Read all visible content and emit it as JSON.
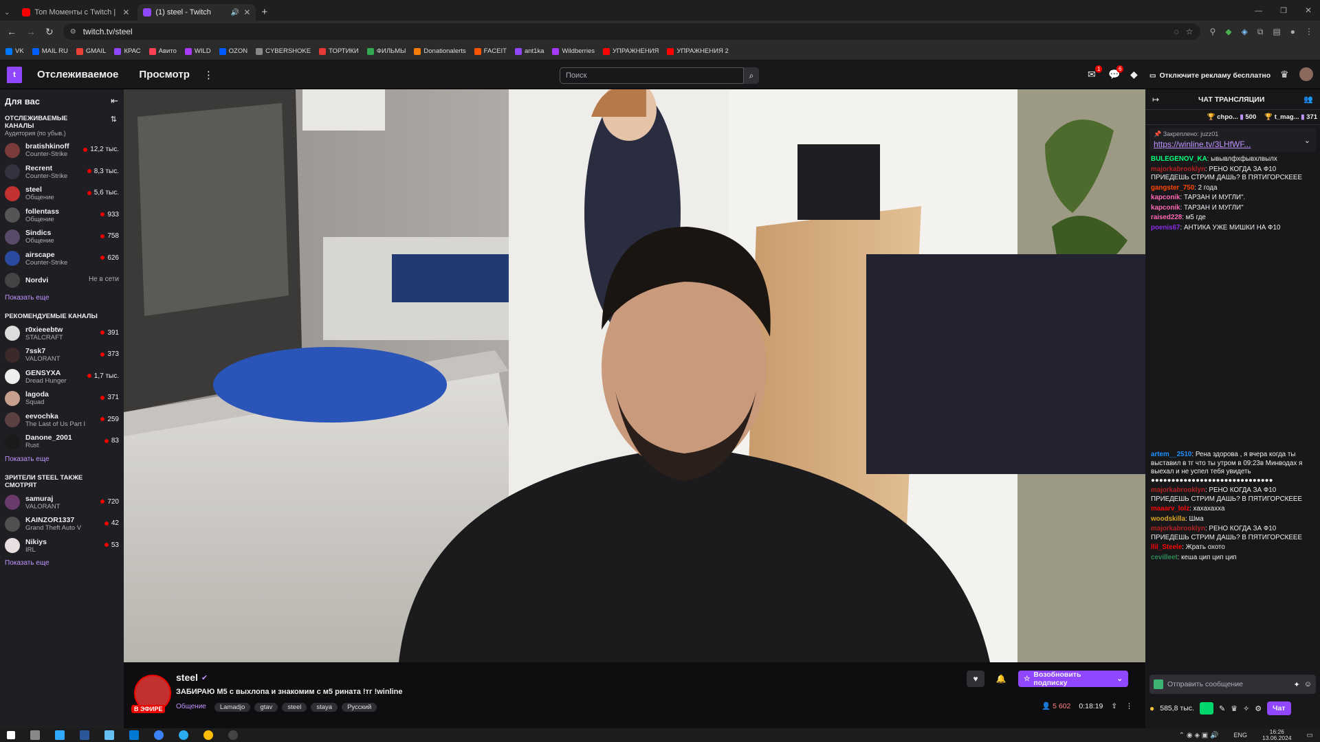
{
  "browser": {
    "tabs": [
      {
        "title": "Топ Моменты с Twitch | Попы…",
        "color": "#ff0000"
      },
      {
        "title": "(1) steel - Twitch",
        "color": "#9147ff"
      }
    ],
    "url": "twitch.tv/steel",
    "bookmarks": [
      {
        "label": "VK",
        "color": "#0077ff"
      },
      {
        "label": "MAIL RU",
        "color": "#005ff9"
      },
      {
        "label": "GMAIL",
        "color": "#ea4335"
      },
      {
        "label": "КРАС",
        "color": "#9147ff"
      },
      {
        "label": "Авито",
        "color": "#ff4053"
      },
      {
        "label": "WILD",
        "color": "#a73afd"
      },
      {
        "label": "OZON",
        "color": "#005bff"
      },
      {
        "label": "CYBERSHOKE",
        "color": "#888888"
      },
      {
        "label": "ТОРТИКИ",
        "color": "#e53935"
      },
      {
        "label": "ФИЛЬМЫ",
        "color": "#34a853"
      },
      {
        "label": "Donationalerts",
        "color": "#f57c00"
      },
      {
        "label": "FACEIT",
        "color": "#ff5500"
      },
      {
        "label": "ant1ka",
        "color": "#9147ff"
      },
      {
        "label": "Wildberries",
        "color": "#a73afd"
      },
      {
        "label": "УПРАЖНЕНИЯ",
        "color": "#ff0000"
      },
      {
        "label": "УПРАЖНЕНИЯ 2",
        "color": "#ff0000"
      }
    ]
  },
  "topnav": {
    "following": "Отслеживаемое",
    "browse": "Просмотр",
    "search_placeholder": "Поиск",
    "notif_badge_1": "1",
    "notif_badge_2": "6",
    "adfree": "Отключите рекламу бесплатно"
  },
  "sidebar": {
    "title": "Для вас",
    "followed_title": "ОТСЛЕЖИВАЕМЫЕ КАНАЛЫ",
    "followed_sub": "Аудитория (по убыв.)",
    "followed": [
      {
        "name": "bratishkinoff",
        "game": "Counter-Strike",
        "viewers": "12,2 тыс.",
        "color": "#7a3b3b"
      },
      {
        "name": "Recrent",
        "game": "Counter-Strike",
        "viewers": "8,3 тыс.",
        "color": "#333340"
      },
      {
        "name": "steel",
        "game": "Общение",
        "viewers": "5,6 тыс.",
        "color": "#c23030"
      },
      {
        "name": "follentass",
        "game": "Общение",
        "viewers": "933",
        "color": "#555555"
      },
      {
        "name": "Sindics",
        "game": "Общение",
        "viewers": "758",
        "color": "#5a4a6a"
      },
      {
        "name": "airscape",
        "game": "Counter-Strike",
        "viewers": "626",
        "color": "#2a4aa0"
      },
      {
        "name": "Nordvi",
        "game": "",
        "viewers": "Не в сети",
        "color": "#444444"
      }
    ],
    "show_more": "Показать еще",
    "recommended_title": "РЕКОМЕНДУЕМЫЕ КАНАЛЫ",
    "recommended": [
      {
        "name": "r0xieeebtw",
        "game": "STALCRAFT",
        "viewers": "391",
        "color": "#dddddd"
      },
      {
        "name": "7ssk7",
        "game": "VALORANT",
        "viewers": "373",
        "color": "#3a2a2a"
      },
      {
        "name": "GENSYXA",
        "game": "Dread Hunger",
        "viewers": "1,7 тыс.",
        "color": "#eeeeee"
      },
      {
        "name": "lagoda",
        "game": "Squad",
        "viewers": "371",
        "color": "#c9a090"
      },
      {
        "name": "eevochka",
        "game": "The Last of Us Part I",
        "viewers": "259",
        "color": "#5a4040"
      },
      {
        "name": "Danone_2001",
        "game": "Rust",
        "viewers": "83",
        "color": "#1a1a1a"
      }
    ],
    "also_title": "ЗРИТЕЛИ STEEL ТАКЖЕ СМОТРЯТ",
    "also": [
      {
        "name": "samuraj",
        "game": "VALORANT",
        "viewers": "720",
        "color": "#6a3a6a"
      },
      {
        "name": "KAINZOR1337",
        "game": "Grand Theft Auto V",
        "viewers": "42",
        "color": "#505050"
      },
      {
        "name": "Nikiys",
        "game": "IRL",
        "viewers": "53",
        "color": "#e8e0e0"
      }
    ]
  },
  "stream": {
    "channel": "steel",
    "live_badge": "В ЭФИРЕ",
    "title": "ЗАБИРАЮ М5 с выхлопа и знакомим с м5 рината !тг !winline",
    "category": "Общение",
    "tags": [
      "Lamadjo",
      "gtav",
      "steel",
      "staya",
      "Русский"
    ],
    "viewers": "5 602",
    "uptime": "0:18:19",
    "subscribe": "Возобновить подписку"
  },
  "chat": {
    "header": "ЧАТ ТРАНСЛЯЦИИ",
    "leaders": [
      {
        "name": "chpo...",
        "amount": "500"
      },
      {
        "name": "t_mag...",
        "amount": "371"
      }
    ],
    "pinned_label": "Закреплено:",
    "pinned_by": "juzz01",
    "pinned_link": "https://winline.tv/3LHfWF...",
    "messages_top": [
      {
        "user": "BULEGENOV_KA",
        "color": "#00ff7f",
        "text": "ывывлфхфывхлвылх"
      },
      {
        "user": "majorkabrooklyn",
        "color": "#b22222",
        "text": "РЕНО КОГДА ЗА Ф10 ПРИЕДЕШЬ СТРИМ ДАШЬ? В ПЯТИГОРСКЕЕЕ"
      },
      {
        "user": "gangster_750",
        "color": "#ff4500",
        "text": "2 года"
      },
      {
        "user": "kapconik",
        "color": "#ff69b4",
        "text": "ТАРЗАН И МУГЛИ\"."
      },
      {
        "user": "kapconik",
        "color": "#ff69b4",
        "text": "ТАРЗАН И МУГЛИ\""
      },
      {
        "user": "raised228",
        "color": "#ff69b4",
        "text": "м5 где"
      },
      {
        "user": "poenis67",
        "color": "#8a2be2",
        "text": "АНТИКА УЖЕ МИШКИ НА Ф10"
      }
    ],
    "messages_bottom": [
      {
        "user": "artem__2510",
        "color": "#1e90ff",
        "text": "Рена здорова , я вчера когда ты выставил в тг что ты утром в 09:23в Минводах я выехал и не успел тебя увидеть ●●●●●●●●●●●●●●●●●●●●●●●●●●●●●●"
      },
      {
        "user": "majorkabrooklyn",
        "color": "#b22222",
        "text": "РЕНО КОГДА ЗА Ф10 ПРИЕДЕШЬ СТРИМ ДАШЬ? В ПЯТИГОРСКЕЕЕ"
      },
      {
        "user": "maaarv_lolz",
        "color": "#ff0000",
        "text": "хахахахха"
      },
      {
        "user": "woodskilla",
        "color": "#daa520",
        "text": "Шма"
      },
      {
        "user": "majorkabrooklyn",
        "color": "#b22222",
        "text": "РЕНО КОГДА ЗА Ф10 ПРИЕДЕШЬ СТРИМ ДАШЬ? В ПЯТИГОРСКЕЕЕ"
      },
      {
        "user": "llil_Steele",
        "color": "#ff0000",
        "text": "Жрать охото"
      },
      {
        "user": "cevilleet",
        "color": "#2e8b57",
        "text": "кеша цип цип цип"
      }
    ],
    "send_placeholder": "Отправить сообщение",
    "points": "585,8 тыс.",
    "chat_btn": "Чат"
  },
  "taskbar": {
    "lang": "ENG",
    "time": "16:26",
    "date": "13.06.2024"
  }
}
